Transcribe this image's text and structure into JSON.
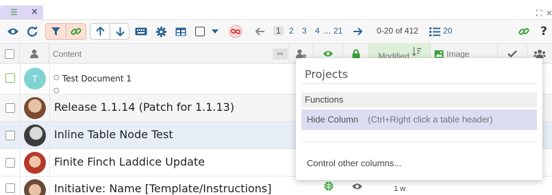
{
  "tab": {
    "close": "×"
  },
  "toolbar": {
    "pages": [
      "1",
      "2",
      "3",
      "4",
      "...",
      "21"
    ],
    "range": "0-20 of 412",
    "per_page": "20"
  },
  "header": {
    "content": "Content",
    "modified": "Modified",
    "image": "Image"
  },
  "rows": [
    {
      "avatar_letter": "T",
      "title": "Test Document 1",
      "bullet": "○",
      "bullet2": "○"
    },
    {
      "title": "Release 1.1.14 (Patch for 1.1.13)"
    },
    {
      "title": "Inline Table Node Test"
    },
    {
      "title": "Finite Finch Laddice Update"
    },
    {
      "title": "Initiative: Name [Template/Instructions]",
      "modified": "1 w"
    }
  ],
  "popup": {
    "title": "Projects",
    "section": "Functions",
    "item_label": "Hide Column",
    "item_hint": "(Ctrl+Right click a table header)",
    "other": "Control other columns..."
  },
  "colors": {
    "accent": "#2a6496",
    "tab": "#ddd6f5",
    "filter_active": "#fde0d4",
    "selected_row": "#e8eef8",
    "popup_highlight": "#dcdcf3",
    "modified_header": "#dff0d8",
    "avatar_t": "#7fd3d3",
    "green_icon": "#3aa23a",
    "red_icon": "#d33"
  }
}
